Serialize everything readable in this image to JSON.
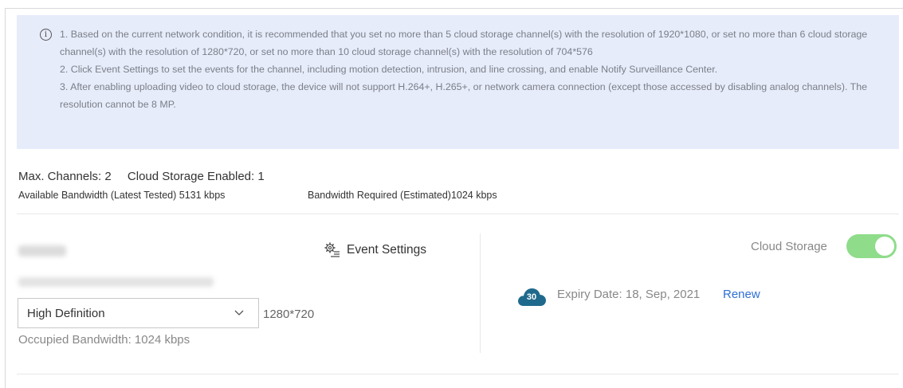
{
  "notice": {
    "icon": "info-circle-icon",
    "lines": [
      "1. Based on the current network condition, it is recommended that you set no more than 5 cloud storage channel(s) with the resolution of 1920*1080, or set no more than 6 cloud storage channel(s) with the resolution of 1280*720, or set no more than 10 cloud storage channel(s) with the resolution of 704*576",
      "2. Click Event Settings to set the events for the channel, including motion detection, intrusion, and line crossing, and enable Notify Surveillance Center.",
      "3. After enabling uploading video to cloud storage, the device will not support H.264+, H.265+, or network camera connection (except those accessed by disabling analog channels). The resolution cannot be 8 MP."
    ]
  },
  "summary": {
    "max_channels": "Max. Channels: 2",
    "cloud_enabled": "Cloud Storage Enabled: 1",
    "available_bandwidth": "Available Bandwidth (Latest Tested) 5131 kbps",
    "required_bandwidth": "Bandwidth Required (Estimated)1024 kbps"
  },
  "channel": {
    "event_settings_label": "Event Settings",
    "event_settings_icon": "gear-list-icon",
    "quality_select_value": "High Definition",
    "resolution": "1280*720",
    "occupied_bandwidth": "Occupied Bandwidth: 1024 kbps",
    "cloud_storage_label": "Cloud Storage",
    "cloud_storage_enabled": true,
    "badge_days": "30",
    "badge_icon": "cloud-icon",
    "expiry": "Expiry Date: 18, Sep, 2021",
    "renew_label": "Renew"
  },
  "colors": {
    "notice_bg": "#e7ecfb",
    "toggle_on": "#8fdc8a",
    "badge": "#1f6a8c",
    "link": "#2f6fd6"
  }
}
